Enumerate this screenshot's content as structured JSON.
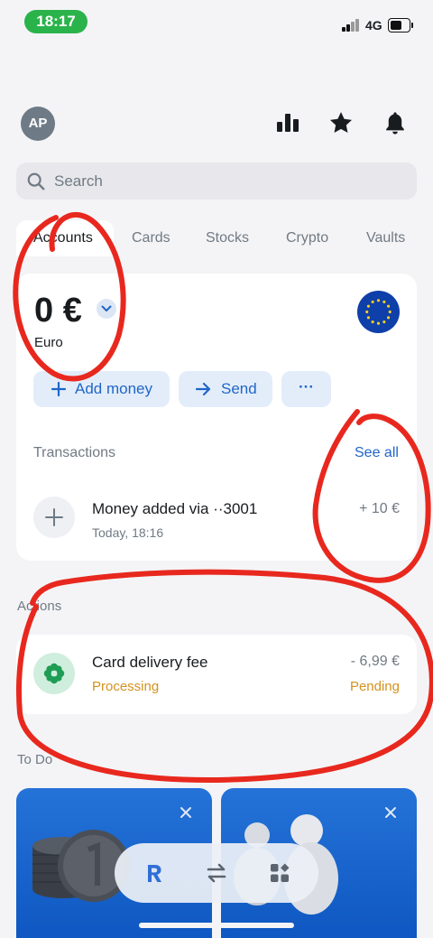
{
  "status_bar": {
    "time": "18:17",
    "network": "4G"
  },
  "header": {
    "avatar_initials": "AP",
    "search_placeholder": "Search"
  },
  "tabs": [
    {
      "label": "Accounts",
      "active": true
    },
    {
      "label": "Cards"
    },
    {
      "label": "Stocks"
    },
    {
      "label": "Crypto"
    },
    {
      "label": "Vaults"
    }
  ],
  "account": {
    "balance": "0 €",
    "currency_name": "Euro",
    "actions": {
      "add_money": "Add money",
      "send": "Send",
      "more": "···"
    }
  },
  "transactions": {
    "section_label": "Transactions",
    "see_all": "See all",
    "items": [
      {
        "title": "Money added via ··3001",
        "subtitle": "Today, 18:16",
        "amount": "+ 10 €"
      }
    ]
  },
  "actions_section": {
    "label": "Actions",
    "items": [
      {
        "title": "Card delivery fee",
        "status": "Processing",
        "amount": "- 6,99 €",
        "state": "Pending"
      }
    ]
  },
  "todo_section": {
    "label": "To Do"
  },
  "colors": {
    "accent_blue": "#1f66c8",
    "pending_orange": "#d3921e",
    "annotation_red": "#e8281e"
  },
  "icons": {
    "header": [
      "chart-bars-icon",
      "star-icon",
      "bell-icon"
    ],
    "dock": [
      "revolut-logo-icon",
      "transfer-arrows-icon",
      "apps-grid-icon"
    ]
  }
}
